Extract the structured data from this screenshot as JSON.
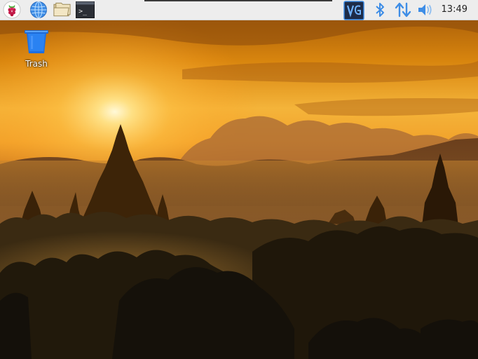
{
  "taskbar": {
    "menu_icon": "raspberry-pi-menu-icon",
    "launchers": [
      {
        "name": "web-browser",
        "icon": "globe-icon"
      },
      {
        "name": "file-manager",
        "icon": "folder-icon"
      },
      {
        "name": "terminal",
        "icon": "terminal-icon"
      }
    ],
    "tray": {
      "vnc_icon": "vnc-icon",
      "bluetooth_icon": "bluetooth-icon",
      "network_icon": "network-updown-icon",
      "volume_icon": "volume-icon",
      "clock": "13:49"
    },
    "colors": {
      "background": "#ededed",
      "accent_blue": "#3e8de6",
      "vnc_bg": "#1e2c48"
    }
  },
  "desktop": {
    "icons": [
      {
        "label": "Trash",
        "icon": "trash-icon"
      }
    ],
    "wallpaper": "sunset-temples"
  }
}
